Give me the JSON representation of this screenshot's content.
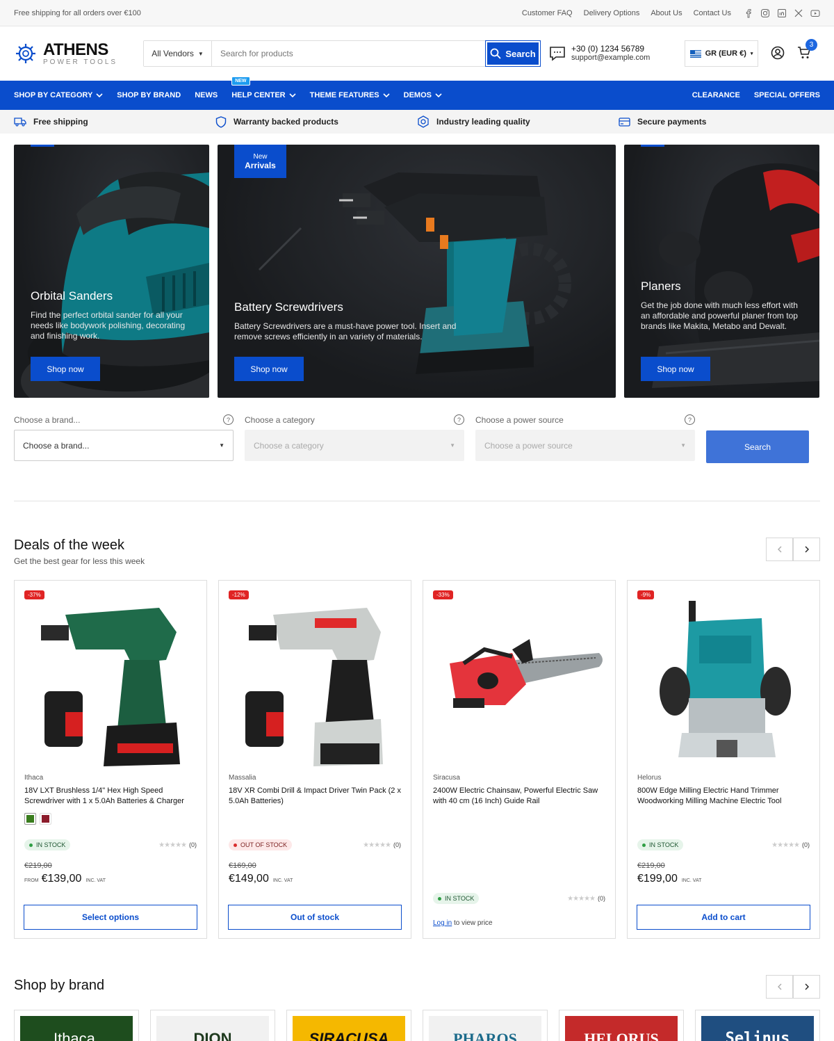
{
  "topbar": {
    "promo": "Free shipping for all orders over €100",
    "links": [
      "Customer FAQ",
      "Delivery Options",
      "About Us",
      "Contact Us"
    ]
  },
  "header": {
    "logo_name": "ATHENS",
    "logo_sub": "POWER TOOLS",
    "vendor_select": "All Vendors",
    "search_placeholder": "Search for products",
    "search_label": "Search",
    "phone": "+30 (0) 1234 56789",
    "email": "support@example.com",
    "currency": "GR (EUR €)",
    "cart_count": "3"
  },
  "nav": {
    "items": [
      "SHOP BY CATEGORY",
      "SHOP BY BRAND",
      "NEWS",
      "HELP CENTER",
      "THEME FEATURES",
      "DEMOS"
    ],
    "new_tag": "NEW",
    "right_items": [
      "CLEARANCE",
      "SPECIAL OFFERS"
    ]
  },
  "usp": [
    "Free shipping",
    "Warranty backed products",
    "Industry leading quality",
    "Secure payments"
  ],
  "hero": [
    {
      "title": "Orbital Sanders",
      "text": "Find the perfect orbital sander for all your needs like bodywork polishing, decorating and finishing work.",
      "cta": "Shop now"
    },
    {
      "tag_top": "New",
      "tag_bottom": "Arrivals",
      "title": "Battery Screwdrivers",
      "text": "Battery Screwdrivers are a must-have power tool. Insert and remove screws efficiently in an variety of materials.",
      "cta": "Shop now"
    },
    {
      "title": "Planers",
      "text": "Get the job done with much less effort with an affordable and powerful planer from top brands like Makita, Metabo and Dewalt.",
      "cta": "Shop now"
    }
  ],
  "finder": {
    "brand_label": "Choose a brand...",
    "brand_value": "Choose a brand...",
    "category_label": "Choose a category",
    "category_value": "Choose a category",
    "power_label": "Choose a power source",
    "power_value": "Choose a power source",
    "help": "?",
    "search": "Search"
  },
  "deals": {
    "title": "Deals of the week",
    "subtitle": "Get the best gear for less this week",
    "products": [
      {
        "discount": "-37%",
        "vendor": "Ithaca",
        "title": "18V LXT Brushless 1/4\" Hex High Speed Screwdriver with 1 x 5.0Ah Batteries & Charger",
        "stock": "IN STOCK",
        "reviews": "(0)",
        "old_price": "€219,00",
        "from": "FROM",
        "price": "€139,00",
        "vat": "INC. VAT",
        "button": "Select options",
        "swatch_colors": [
          "#3a7d1e",
          "#8c1c2b"
        ]
      },
      {
        "discount": "-12%",
        "vendor": "Massalia",
        "title": "18V XR Combi Drill & Impact Driver Twin Pack (2 x 5.0Ah Batteries)",
        "stock": "OUT OF STOCK",
        "reviews": "(0)",
        "old_price": "€169,00",
        "price": "€149,00",
        "vat": "INC. VAT",
        "button": "Out of stock"
      },
      {
        "discount": "-33%",
        "vendor": "Siracusa",
        "title": "2400W Electric Chainsaw, Powerful Electric Saw with 40 cm (16 Inch) Guide Rail",
        "stock": "IN STOCK",
        "reviews": "(0)",
        "login_link": "Log in",
        "login_text": "to view price"
      },
      {
        "discount": "-9%",
        "vendor": "Helorus",
        "title": "800W Edge Milling Electric Hand Trimmer Woodworking Milling Machine Electric Tool",
        "stock": "IN STOCK",
        "reviews": "(0)",
        "old_price": "€219,00",
        "price": "€199,00",
        "vat": "INC. VAT",
        "button": "Add to cart"
      }
    ]
  },
  "brands": {
    "title": "Shop by brand",
    "items": [
      {
        "name": "Ithaca.",
        "bg": "#1e4d1e",
        "fg": "#ffffff"
      },
      {
        "name": "DION",
        "bg": "#f1f1f1",
        "fg": "#1e3a1e"
      },
      {
        "name": "SIRACUSA",
        "bg": "#f5b800",
        "fg": "#111111"
      },
      {
        "name": "PHAROS",
        "bg": "#f1f1f1",
        "fg": "#1b6a8a"
      },
      {
        "name": "HELORUS",
        "bg": "#c42a2a",
        "fg": "#ffffff"
      },
      {
        "name": "Selinus",
        "bg": "#1f4e80",
        "fg": "#ffffff"
      }
    ]
  },
  "colors": {
    "primary": "#0a4dcc",
    "discount": "#e02424"
  }
}
